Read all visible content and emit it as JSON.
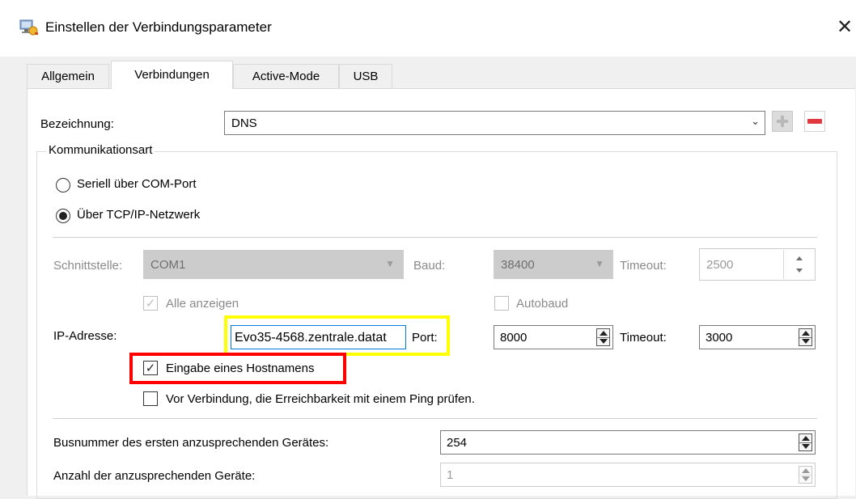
{
  "window": {
    "title": "Einstellen der Verbindungsparameter",
    "close_glyph": "✕"
  },
  "tabs": [
    {
      "label": "Allgemein",
      "active": false
    },
    {
      "label": "Verbindungen",
      "active": true
    },
    {
      "label": "Active-Mode",
      "active": false
    },
    {
      "label": "USB",
      "active": false
    }
  ],
  "bezeichnung": {
    "label": "Bezeichnung:",
    "value": "DNS"
  },
  "kommunikationsart": {
    "legend": "Kommunikationsart",
    "options": [
      {
        "label": "Seriell über COM-Port",
        "selected": false
      },
      {
        "label": "Über TCP/IP-Netzwerk",
        "selected": true
      }
    ]
  },
  "serial": {
    "schnittstelle_label": "Schnittstelle:",
    "schnittstelle_value": "COM1",
    "baud_label": "Baud:",
    "baud_value": "38400",
    "timeout_label": "Timeout:",
    "timeout_value": "2500",
    "alle_anzeigen_label": "Alle anzeigen",
    "alle_anzeigen_checked": true,
    "autobaud_label": "Autobaud",
    "autobaud_checked": false
  },
  "tcp": {
    "ip_label": "IP-Adresse:",
    "ip_value": "Evo35-4568.zentrale.datat",
    "port_label": "Port:",
    "port_value": "8000",
    "timeout_label": "Timeout:",
    "timeout_value": "3000",
    "hostname_label": "Eingabe eines Hostnamens",
    "hostname_checked": true,
    "ping_label": "Vor Verbindung, die Erreichbarkeit mit einem Ping prüfen.",
    "ping_checked": false
  },
  "bus": {
    "first_label": "Busnummer des ersten anzusprechenden Gerätes:",
    "first_value": "254",
    "count_label": "Anzahl der anzusprechenden Geräte:",
    "count_value": "1"
  },
  "colors": {
    "highlight_yellow": "#ffff00",
    "highlight_red": "#ff0000",
    "focus_blue": "#0078d7",
    "remove_red": "#e0383e"
  }
}
